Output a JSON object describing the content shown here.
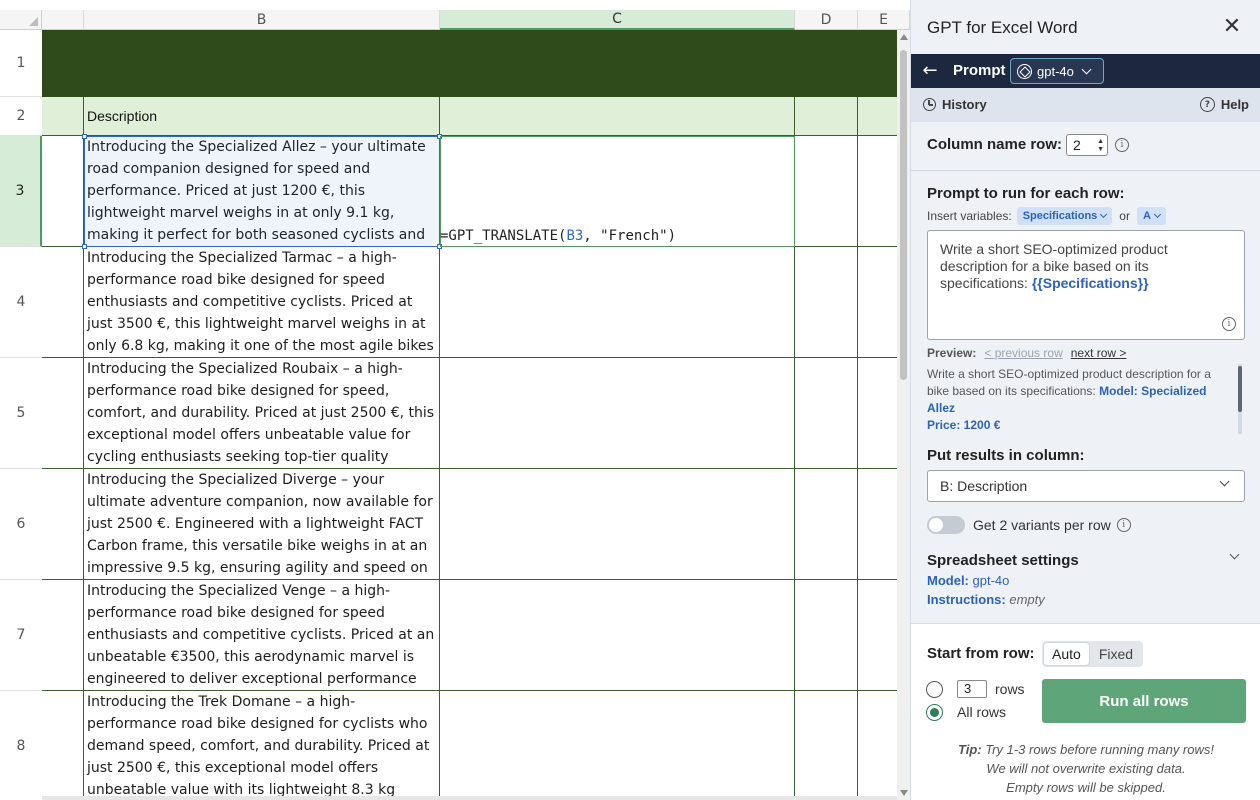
{
  "sheet": {
    "columns": [
      "B",
      "C",
      "D",
      "E"
    ],
    "rows": [
      "1",
      "2",
      "3",
      "4",
      "5",
      "6",
      "7",
      "8"
    ],
    "header_cell": "Description",
    "formula": {
      "prefix": "=GPT_TRANSLATE(",
      "ref": "B3",
      "suffix": ", \"French\")"
    },
    "descriptions": [
      "Introducing the Specialized Allez – your ultimate road companion designed for speed and performance. Priced at just 1200 €, this lightweight marvel weighs in at only 9.1 kg, making it perfect for both seasoned cyclists and enthusiastic beginners seeking a",
      "Introducing the Specialized Tarmac – a high-performance road bike designed for speed enthusiasts and competitive cyclists. Priced at just 3500 €, this lightweight marvel weighs in at only 6.8 kg, making it one of the most agile bikes on the market.",
      "Introducing the Specialized Roubaix – a high-performance road bike designed for speed, comfort, and durability. Priced at just 2500 €, this exceptional model offers unbeatable value for cycling enthusiasts seeking top-tier quality without breaking",
      "Introducing the Specialized Diverge – your ultimate adventure companion, now available for just 2500 €. Engineered with a lightweight FACT Carbon frame, this versatile bike weighs in at an impressive 9.5 kg, ensuring agility and speed on any terrain. Whether",
      "Introducing the Specialized Venge – a high-performance road bike designed for speed enthusiasts and competitive cyclists. Priced at an unbeatable €3500, this aerodynamic marvel is engineered to deliver exceptional performance without",
      "Introducing the Trek Domane – a high-performance road bike designed for cyclists who demand speed, comfort, and durability. Priced at just 2500 €, this exceptional model offers unbeatable value with its lightweight 8.3 kg frame crafted from premium carbon"
    ]
  },
  "panel": {
    "title": "GPT for Excel Word",
    "nav_label": "Prompt",
    "model": "gpt-4o",
    "history": "History",
    "help": "Help",
    "column_name_row_label": "Column name row:",
    "column_name_row_value": "2",
    "prompt_label": "Prompt to run for each row:",
    "insert_label": "Insert variables:",
    "var1": "Specifications",
    "or": "or",
    "var2": "A",
    "prompt_text": "Write a short SEO-optimized product description for a bike based on its specifications: ",
    "prompt_var": "{{Specifications}}",
    "preview_label": "Preview:",
    "prev_row": "< previous row",
    "next_row": "next row >",
    "preview_text": "Write a short SEO-optimized product description for a bike based on its specifications: ",
    "preview_model": "Model: Specialized Allez",
    "preview_price": "Price: 1200 €",
    "put_results_label": "Put results in column:",
    "put_results_value": "B: Description",
    "variants_label": "Get 2 variants per row",
    "variants_enabled": false,
    "spreadsheet_settings": "Spreadsheet settings",
    "model_label": "Model:",
    "model_value": "gpt-4o",
    "instructions_label": "Instructions:",
    "instructions_value": "empty",
    "start_from_label": "Start from row:",
    "start_auto": "Auto",
    "start_fixed": "Fixed",
    "rows_count": "3",
    "rows_label": "rows",
    "all_rows_label": "All rows",
    "run_button": "Run all rows",
    "tip_prefix": "Tip:",
    "tip_line1": " Try 1-3 rows before running many rows!",
    "tip_line2": "We will not overwrite existing data.",
    "tip_line3": "Empty rows will be skipped."
  },
  "colors": {
    "title_band": "#2f4a1b",
    "header_band": "#e0efd8",
    "run_button": "#5ea67a",
    "nav_bar": "#1d2840",
    "accent_blue": "#2d62b8"
  }
}
